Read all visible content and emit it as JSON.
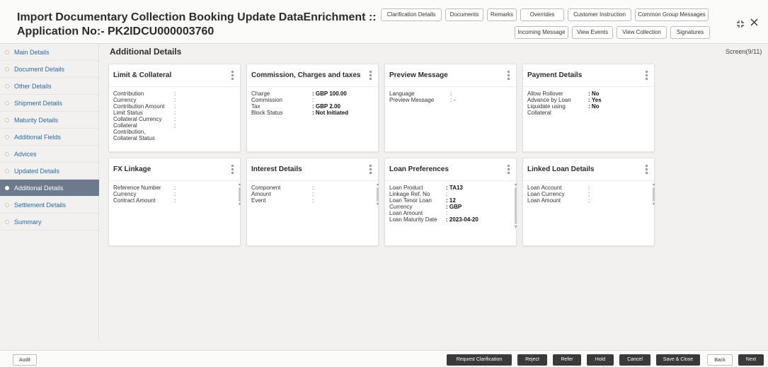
{
  "header": {
    "title_line1": "Import Documentary Collection Booking Update DataEnrichment ::",
    "title_line2": "Application No:- PK2IDCU000003760",
    "buttons_row1": [
      "Clarification Details",
      "Documents",
      "Remarks",
      "Overrides",
      "Customer Instruction",
      "Common Group Messages"
    ],
    "buttons_row2": [
      "Incoming Message",
      "View Events",
      "View Collection",
      "Signatures"
    ]
  },
  "sidebar": {
    "items": [
      {
        "label": "Main Details"
      },
      {
        "label": "Document Details"
      },
      {
        "label": "Other Details"
      },
      {
        "label": "Shipment Details"
      },
      {
        "label": "Maturity Details"
      },
      {
        "label": "Additional Fields"
      },
      {
        "label": "Advices"
      },
      {
        "label": "Updated Details"
      },
      {
        "label": "Additional Details"
      },
      {
        "label": "Settlement Details"
      },
      {
        "label": "Summary"
      }
    ],
    "active_index": 8
  },
  "main": {
    "section_title": "Additional Details",
    "screen_indicator": "Screen(9/11)"
  },
  "cards": [
    {
      "title": "Limit & Collateral",
      "rows": [
        {
          "label": "Contribution",
          "sep": ":",
          "value": ""
        },
        {
          "label": "Currency",
          "sep": ":",
          "value": ""
        },
        {
          "label": "Contribution Amount",
          "sep": ":",
          "value": ""
        },
        {
          "label": "Limit Status",
          "sep": ":",
          "value": ""
        },
        {
          "label": "Collateral Currency",
          "sep": ":",
          "value": ""
        },
        {
          "label": "Collateral",
          "sep": ":",
          "value": ""
        },
        {
          "label": "Contribution,",
          "sep": "",
          "value": ""
        },
        {
          "label": "Collateral Status",
          "sep": "",
          "value": ""
        }
      ]
    },
    {
      "title": "Commission, Charges and taxes",
      "rows": [
        {
          "label": "Charge",
          "sep": ":",
          "value": "GBP 100.00"
        },
        {
          "label": "Commission",
          "sep": ":",
          "value": ""
        },
        {
          "label": "Tax",
          "sep": ":",
          "value": "GBP 2.00"
        },
        {
          "label": "Block Status",
          "sep": ":",
          "value": "Not Initiated"
        }
      ]
    },
    {
      "title": "Preview Message",
      "rows": [
        {
          "label": "Language",
          "sep": ":",
          "value": ""
        },
        {
          "label": "Preview Message",
          "sep": ":",
          "value": "-"
        }
      ]
    },
    {
      "title": "Payment Details",
      "rows": [
        {
          "label": "Allow Rollover",
          "sep": ":",
          "value": "No"
        },
        {
          "label": "Advance by Loan",
          "sep": ":",
          "value": "Yes"
        },
        {
          "label": "Liquidate using",
          "sep": ":",
          "value": "No"
        },
        {
          "label": "Collateral",
          "sep": "",
          "value": ""
        }
      ]
    },
    {
      "title": "FX Linkage",
      "rows": [
        {
          "label": "Reference Number",
          "sep": ":",
          "value": ""
        },
        {
          "label": "Currency",
          "sep": ":",
          "value": ""
        },
        {
          "label": "Contract Amount",
          "sep": ":",
          "value": ""
        }
      ]
    },
    {
      "title": "Interest Details",
      "rows": [
        {
          "label": "Component",
          "sep": ":",
          "value": ""
        },
        {
          "label": "Amount",
          "sep": ":",
          "value": ""
        },
        {
          "label": "Event",
          "sep": ":",
          "value": ""
        }
      ]
    },
    {
      "title": "Loan Preferences",
      "rows": [
        {
          "label": "Loan Product",
          "sep": ":",
          "value": "TA13"
        },
        {
          "label": "Linkage Ref. No",
          "sep": ":",
          "value": ""
        },
        {
          "label": "Loan Tenor Loan",
          "sep": ":",
          "value": "12"
        },
        {
          "label": "Currency",
          "sep": ":",
          "value": "GBP"
        },
        {
          "label": "Loan Amount",
          "sep": ":",
          "value": ""
        },
        {
          "label": "Loan Maturity Date",
          "sep": ":",
          "value": "2023-04-20"
        }
      ]
    },
    {
      "title": "Linked Loan Details",
      "rows": [
        {
          "label": "Loan Account",
          "sep": ":",
          "value": ""
        },
        {
          "label": "Loan Currency",
          "sep": ":",
          "value": ""
        },
        {
          "label": "Loan Amount",
          "sep": ":",
          "value": ""
        }
      ]
    }
  ],
  "footer": {
    "audit": "Audit",
    "buttons": [
      "Request Clarification",
      "Reject",
      "Refer",
      "Hold",
      "Cancel",
      "Save & Close",
      "Back",
      "Next"
    ]
  }
}
